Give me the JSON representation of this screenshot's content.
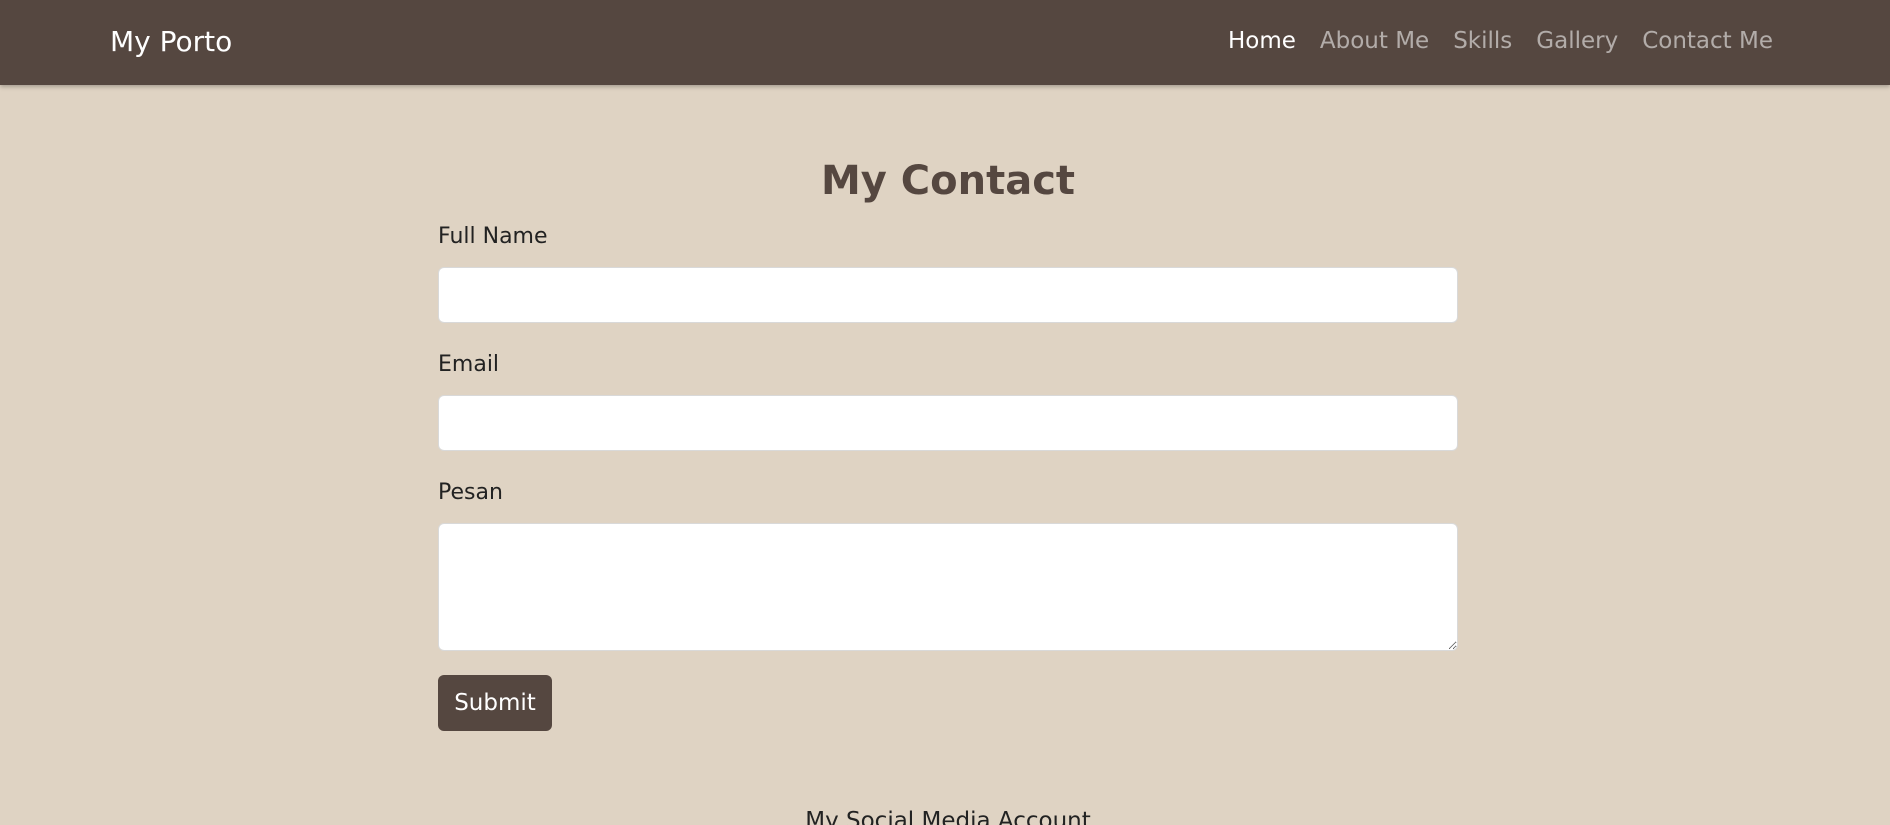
{
  "navbar": {
    "brand": "My Porto",
    "links": [
      {
        "label": "Home"
      },
      {
        "label": "About Me"
      },
      {
        "label": "Skills"
      },
      {
        "label": "Gallery"
      },
      {
        "label": "Contact Me"
      }
    ]
  },
  "contact": {
    "title": "My Contact",
    "fields": {
      "full_name": {
        "label": "Full Name",
        "value": ""
      },
      "email": {
        "label": "Email",
        "value": ""
      },
      "message": {
        "label": "Pesan",
        "value": ""
      }
    },
    "submit_label": "Submit"
  },
  "footer": {
    "heading": "My Social Media Account"
  },
  "colors": {
    "page_background": "#dfd3c3",
    "navbar_background": "#554740",
    "accent": "#554740"
  }
}
